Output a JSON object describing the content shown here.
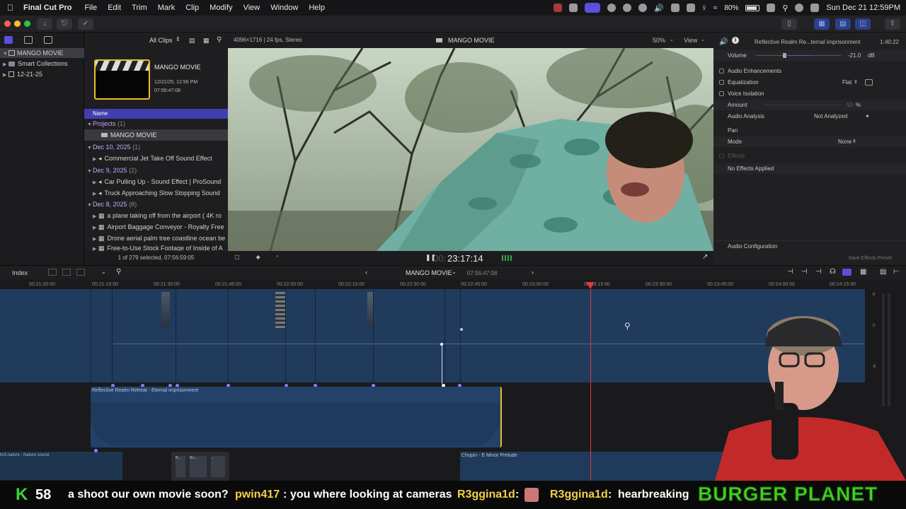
{
  "menubar": {
    "app": "Final Cut Pro",
    "items": [
      "File",
      "Edit",
      "Trim",
      "Mark",
      "Clip",
      "Modify",
      "View",
      "Window",
      "Help"
    ],
    "battery": "80%",
    "datetime": "Sun Dec 21  12:59PM"
  },
  "sidebar": {
    "library": "MANGO MOVIE",
    "items": [
      "Smart Collections",
      "12-21-25"
    ]
  },
  "browser": {
    "filter": "All Clips",
    "project_name": "MANGO MOVIE",
    "project_date": "12/21/25, 12:56 PM",
    "project_duration": "07:56:47:08",
    "column_name": "Name",
    "groups": [
      {
        "label": "Projects",
        "count": "(1)",
        "items": [
          "MANGO MOVIE"
        ]
      },
      {
        "label": "Dec 10, 2025",
        "count": "(1)",
        "items": [
          "Commercial Jet Take Off Sound Effect"
        ]
      },
      {
        "label": "Dec 9, 2025",
        "count": "(2)",
        "items": [
          "Car Pulling Up - Sound Effect  |  ProSound",
          "Truck Approaching Slow Stopping Sound"
        ]
      },
      {
        "label": "Dec 8, 2025",
        "count": "(8)",
        "items": [
          "a plane taking off from the airport ( 4K ro",
          "Airport Baggage Conveyor - Royalty Free",
          "Drone aerial palm tree coastline ocean be",
          "Free-to-Use Stock Footage of Inside of A"
        ]
      }
    ],
    "status": "1 of 279 selected, 07:56:59:05"
  },
  "viewer": {
    "format": "4096×1716 | 24 fps, Stereo",
    "title": "MANGO MOVIE",
    "zoom": "50%",
    "view_menu": "View",
    "timecode": "23:17:14",
    "timecode_prefix": "00:"
  },
  "inspector": {
    "clip_title": "Reflective Realm Re...ternal imprisonment",
    "clip_duration": "1:40:22",
    "volume_label": "Volume",
    "volume_value": "-21.0",
    "volume_unit": "dB",
    "section_audio_enh": "Audio Enhancements",
    "equalization_label": "Equalization",
    "equalization_value": "Flat",
    "voice_isolation_label": "Voice Isolation",
    "amount_label": "Amount",
    "amount_value": "50",
    "amount_unit": "%",
    "audio_analysis_label": "Audio Analysis",
    "audio_analysis_value": "Not Analyzed",
    "pan_label": "Pan",
    "mode_label": "Mode",
    "mode_value": "None",
    "effects_label": "Effects",
    "no_effects": "No Effects Applied",
    "audio_config": "Audio Configuration",
    "save_preset": "Save Effects Preset"
  },
  "timeline": {
    "index_label": "Index",
    "project_name": "MANGO MOVIE",
    "project_duration": "07:56:47:08",
    "ruler": [
      "00:21:00:00",
      "00:21:15:00",
      "00:21:30:00",
      "00:21:45:00",
      "00:22:00:00",
      "00:22:15:00",
      "00:22:30:00",
      "00:22:45:00",
      "00:23:00:00",
      "00:23:15:00",
      "00:23:30:00",
      "00:23:45:00",
      "00:24:00:00",
      "00:24:15:00"
    ],
    "audio_clip_main": "Reflective Realm Retreat - Eternal imprisonment",
    "audio_clip_nature": "liv3.nature - Nature sound",
    "audio_clip_chopin": "Chopin - E Minor Prelude",
    "small_clip_labels": [
      "B...",
      "Bo...",
      "..."
    ],
    "meter_labels": [
      "6",
      "0",
      "-6"
    ]
  },
  "chat": {
    "k_count": "58",
    "messages": [
      {
        "user": "",
        "text": "a shoot our own movie soon?"
      },
      {
        "user": "pwin417",
        "text": "you where looking at cameras"
      },
      {
        "user": "R3ggina1d",
        "text": ""
      },
      {
        "user": "R3ggina1d",
        "text": "hearbreaking"
      }
    ],
    "banner": "BURGER PLANET"
  },
  "colors": {
    "accent_purple": "#5b4fe0",
    "timeline_blue": "#1f3a5c",
    "playhead": "#e03a3a",
    "chat_green": "#3ad43a",
    "banner_green": "#41d41f"
  }
}
